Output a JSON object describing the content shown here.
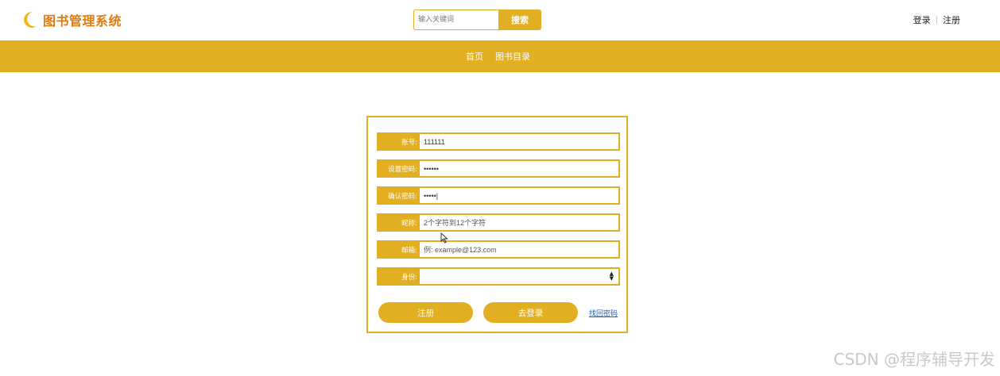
{
  "header": {
    "title": "图书管理系统",
    "search_placeholder": "输入关键词",
    "search_button": "搜索",
    "login": "登录",
    "register": "注册"
  },
  "nav": {
    "items": [
      "首页",
      "图书目录"
    ]
  },
  "form": {
    "fields": [
      {
        "label": "账号:",
        "value": "111111",
        "placeholder": ""
      },
      {
        "label": "设置密码:",
        "value": "••••••",
        "placeholder": ""
      },
      {
        "label": "确认密码:",
        "value": "•••••|",
        "placeholder": ""
      },
      {
        "label": "昵称:",
        "value": "",
        "placeholder": "2个字符到12个字符"
      },
      {
        "label": "邮箱:",
        "value": "",
        "placeholder": "例: example@123.com"
      },
      {
        "label": "身份:",
        "value": "",
        "placeholder": ""
      }
    ],
    "register_button": "注册",
    "login_button": "去登录",
    "recover_link": "找回密码"
  },
  "watermark": "CSDN @程序辅导开发",
  "colors": {
    "accent": "#e2ae22",
    "logo_text": "#e07b10",
    "link": "#1a5fb4"
  }
}
